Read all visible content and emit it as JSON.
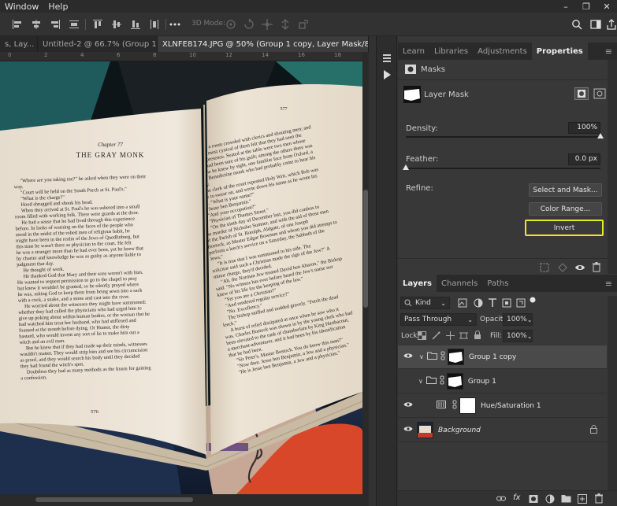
{
  "menubar": {
    "items": [
      "Window",
      "Help"
    ],
    "controls": [
      "–",
      "❐",
      "✕"
    ]
  },
  "optionsbar": {
    "mode3d": "3D Mode:"
  },
  "tabs": [
    {
      "label": "s, Lay...",
      "close": "×"
    },
    {
      "label": "Untitled-2 @ 66.7% (Group 1, R...",
      "close": "×"
    },
    {
      "label": "XLNFE8174.JPG @ 50% (Group 1 copy, Layer Mask/8) *",
      "close": "×"
    }
  ],
  "ruler": [
    "0",
    "2",
    "4",
    "6",
    "8",
    "10",
    "12",
    "14",
    "16",
    "18"
  ],
  "book": {
    "left_heading": "Chapter 77",
    "left_title": "THE GRAY MONK",
    "left_page_number": "576",
    "right_page_number": "577",
    "left_paragraphs": [
      "\"Where are you taking me?\" he asked when they were on their way.",
      "\"Court will be held on the South Porch at St. Paul's.\"",
      "\"What is the charge?\"",
      "Hood shrugged and shook his head.",
      "When they arrived at St. Paul's he was ushered into a small room filled with working folk. There were guards at the door.",
      "He had a sense that he had lived through this experience before. In looks of warning on the faces of the people who stood in the midst of the robed men of religious habit, he might have been in the realm of the Jews of Quedlinburg, but this time he wasn't there as physician to the court. He felt he was a stranger more than he had ever been, yet he knew that by charter and knowledge he was as guilty as anyone liable to judgment that day.",
      "He thought of work.",
      "He thanked God that Mary and their sons weren't with him. He wanted to request permission to go to the chapel to pray but knew it wouldn't be granted, so he silently prayed where he was, asking God to keep them from being sewn into a sack with a cock, a snake, and a stone and cast into the river.",
      "He worried about the witnesses they might have summoned: whether they had called the physicians who had urged him to give up poking about within human bodies, or the woman that he had watched him treat her husband, who had stiffened and foamed at the mouth before dying. Or Hunter, the dirty bastard, who would invent any sort of lie to make him out a witch and an evil man.",
      "But he knew that if they had made up their minds, witnesses wouldn't matter. They would strip him and see his circumcision as proof, and they would search his body until they decided they had found the witch's spot.",
      "Doubtless they had as many methods as the Imam for gaining a confession."
    ],
    "right_paragraphs": [
      "It was a room crowded with clerics and shouting men; and even the most cynical of them felt that they had seen the cleric's presence. Seated at the table were two men whose minds had been sure of his guilt; among the others there was only one he knew by sight, one familiar face from Oxford, a young Benedictine monk who had probably come to hear his heresy.",
      "The clerk of the court repeated Holy Writ, which Rob was made to swear on, and wrote down his name as he wrote his own. \"What is your name?\"",
      "\"Jesse ben Benjamin.\"",
      "\"And your occupation?\"",
      "\"Physician of Thames Street.\"",
      "\"On the ninth day of December last, you did confess to the murder of Nicholas Sumner, and with the aid of those men of the Parish of St. Botolph, Aldgate, of one Joseph Bostock, as Master Edgar Bowman and whom you did attempt to perform a leech's service on a Saturday, the Sabbath of the Jews.\"",
      "\"It is true that I was summoned to his side. The solicitor said such a Christian made the sign of the Jew?\" A minor charge, they'd decided.",
      "\"Ah, the Norman Jew treated David ben Abaron,\" the Bishop said. \"No witness has ever before heard the Jew's name nor knew of his life for the keeping of the law.\"",
      "\"Yet you are a Christian?\"",
      "\"And rendered regular service?\"",
      "\"No. Excellency.\"",
      "The bishop sniffed and nodded gravely. \"Fetch the dead leech.\"",
      "A burst of relief dissipated at once when he saw who it was. Charles Bostock was shown in by the young clerk who had been elevated to the rank of chamberlain by King Harthacnut, a merchant-adventurer, and it had been by his identification that he had been.",
      "\"Sir Peter's, Master Bostock. You do know this man?\"",
      "\"Now then. Jesse ben Benjamin, a Jew and a physician.\"",
      "\"He is Jesse ben Benjamin, a Jew and a physician.\""
    ]
  },
  "panel_tabs_top": {
    "tabs": [
      "Learn",
      "Libraries",
      "Adjustments",
      "Properties"
    ],
    "active": "Properties"
  },
  "properties": {
    "masks_label": "Masks",
    "layer_mask_label": "Layer Mask",
    "density_label": "Density:",
    "density_value": "100%",
    "density_level": 1.0,
    "feather_label": "Feather:",
    "feather_value": "0.0 px",
    "feather_level": 0.0,
    "refine_label": "Refine:",
    "select_mask_btn": "Select and Mask...",
    "color_range_btn": "Color Range...",
    "invert_btn": "Invert"
  },
  "panel_tabs_bottom": {
    "tabs": [
      "Layers",
      "Channels",
      "Paths"
    ],
    "active": "Layers"
  },
  "layers_panel": {
    "kind_label": "Kind",
    "blend_mode": "Pass Through",
    "opacity_label": "Opacity:",
    "opacity_value": "100%",
    "lock_label": "Lock:",
    "fill_label": "Fill:",
    "fill_value": "100%",
    "layers": [
      {
        "name": "Group 1 copy",
        "type": "group",
        "selected": true
      },
      {
        "name": "Group 1",
        "type": "group",
        "selected": false
      },
      {
        "name": "Hue/Saturation 1",
        "type": "adjustment",
        "selected": false
      },
      {
        "name": "Background",
        "type": "background",
        "selected": false
      }
    ],
    "footer_icons": [
      "link-icon",
      "fx-icon",
      "mask-icon",
      "adjustment-icon",
      "folder-icon",
      "new-layer-icon",
      "trash-icon"
    ]
  },
  "colors": {
    "accent_invert_border": "#e8e82a",
    "panel_bg": "#383838",
    "selected_row": "#4a4a4a"
  }
}
